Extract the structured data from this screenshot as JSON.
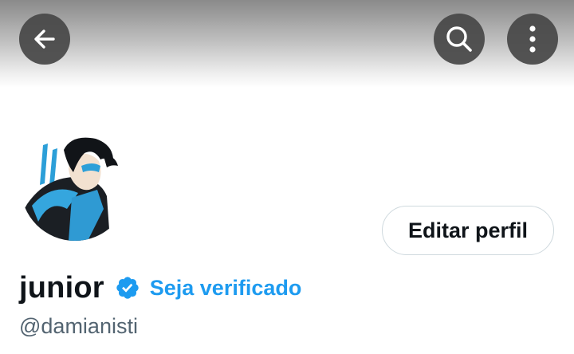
{
  "header": {
    "back_icon": "arrow-left-icon",
    "search_icon": "search-icon",
    "more_icon": "more-vertical-icon"
  },
  "profile": {
    "display_name": "junior",
    "verified_badge_icon": "verified-badge-icon",
    "verify_link": "Seja verificado",
    "handle": "@damianisti",
    "edit_button": "Editar perfil"
  },
  "colors": {
    "accent": "#1d9bf0",
    "text_primary": "#0f1419",
    "text_secondary": "#536471",
    "button_border": "#cfd9de"
  }
}
